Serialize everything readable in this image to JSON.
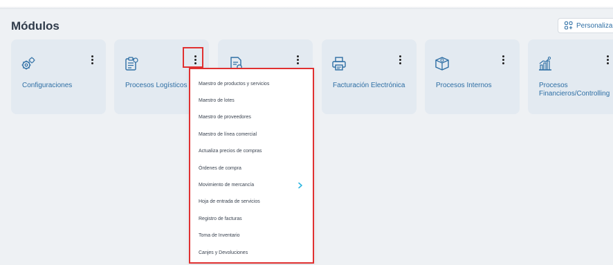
{
  "header": {
    "title": "Módulos",
    "personalize_label": "Personalizar"
  },
  "modules": [
    {
      "label": "Configuraciones",
      "icon": "gears-icon"
    },
    {
      "label": "Procesos Logísticos",
      "icon": "clipboard-icon"
    },
    {
      "label": "",
      "icon": "invoice-document-icon"
    },
    {
      "label": "Facturación Electrónica",
      "icon": "printer-icon"
    },
    {
      "label": "Procesos Internos",
      "icon": "box-icon"
    },
    {
      "label": "Procesos Financieros/Controlling",
      "icon": "chart-icon"
    }
  ],
  "menu": {
    "items": [
      {
        "label": "Maestro de productos y servicios"
      },
      {
        "label": "Maestro de lotes"
      },
      {
        "label": "Maestro de proveedores"
      },
      {
        "label": "Maestro de línea comercial"
      },
      {
        "label": "Actualiza precios de compras"
      },
      {
        "label": "Órdenes de compra"
      },
      {
        "label": "Movimiento de mercancía",
        "submenu": true
      },
      {
        "label": "Hoja de entrada de servicios"
      },
      {
        "label": "Registro de facturas"
      },
      {
        "label": "Toma de Inventario"
      },
      {
        "label": "Canjes y Devoluciones"
      }
    ]
  },
  "colors": {
    "accent": "#2d6ea4",
    "card_bg": "#e3eaf1",
    "highlight": "#e03030",
    "chevron": "#2bb5e0"
  }
}
